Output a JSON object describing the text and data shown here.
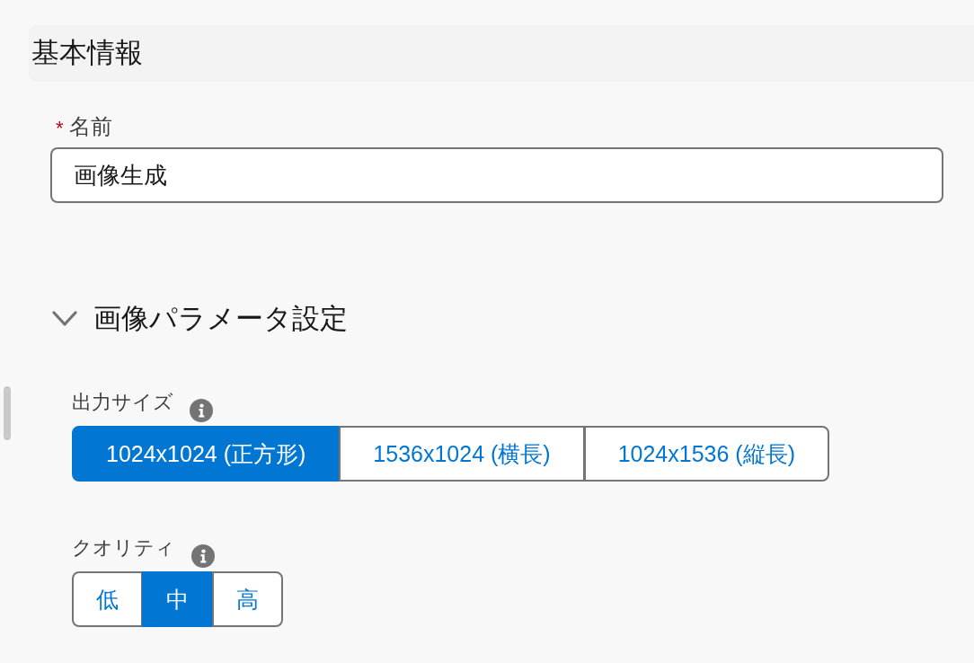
{
  "basic_info": {
    "title": "基本情報",
    "name_field": {
      "required_marker": "*",
      "label": "名前",
      "value": "画像生成"
    }
  },
  "image_params": {
    "title": "画像パラメータ設定",
    "expanded": true,
    "groups": [
      {
        "label": "出力サイズ",
        "options": [
          {
            "label": "1024x1024 (正方形)",
            "selected": true
          },
          {
            "label": "1536x1024 (横長)",
            "selected": false
          },
          {
            "label": "1024x1536 (縦長)",
            "selected": false
          }
        ]
      },
      {
        "label": "クオリティ",
        "options": [
          {
            "label": "低",
            "selected": false
          },
          {
            "label": "中",
            "selected": true
          },
          {
            "label": "高",
            "selected": false
          }
        ]
      }
    ]
  }
}
